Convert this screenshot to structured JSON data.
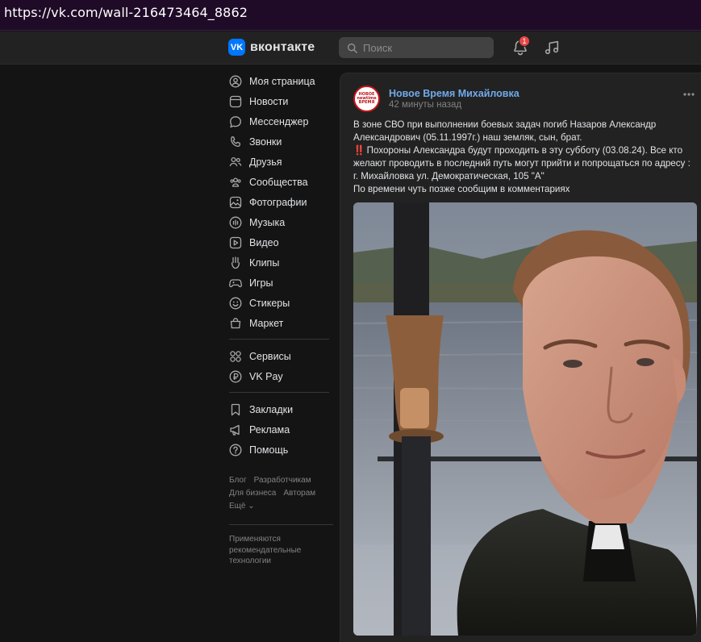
{
  "browser": {
    "url": "https://vk.com/wall-216473464_8862"
  },
  "header": {
    "logo_text": "вконтакте",
    "logo_mark": "VK",
    "search_placeholder": "Поиск",
    "notifications_count": "1",
    "icons": [
      "search-icon",
      "bell-icon",
      "music-icon"
    ],
    "accent": "#0077ff",
    "badge_color": "#e64646"
  },
  "sidebar": {
    "items": [
      {
        "label": "Моя страница",
        "icon": "profile-icon"
      },
      {
        "label": "Новости",
        "icon": "news-icon"
      },
      {
        "label": "Мессенджер",
        "icon": "messenger-icon"
      },
      {
        "label": "Звонки",
        "icon": "phone-icon"
      },
      {
        "label": "Друзья",
        "icon": "friends-icon"
      },
      {
        "label": "Сообщества",
        "icon": "communities-icon"
      },
      {
        "label": "Фотографии",
        "icon": "photos-icon"
      },
      {
        "label": "Музыка",
        "icon": "music-icon"
      },
      {
        "label": "Видео",
        "icon": "video-icon"
      },
      {
        "label": "Клипы",
        "icon": "clips-icon"
      },
      {
        "label": "Игры",
        "icon": "games-icon"
      },
      {
        "label": "Стикеры",
        "icon": "stickers-icon"
      },
      {
        "label": "Маркет",
        "icon": "market-icon"
      }
    ],
    "services": [
      {
        "label": "Сервисы",
        "icon": "services-icon"
      },
      {
        "label": "VK Pay",
        "icon": "vkpay-icon"
      }
    ],
    "extra": [
      {
        "label": "Закладки",
        "icon": "bookmark-icon"
      },
      {
        "label": "Реклама",
        "icon": "ads-icon"
      },
      {
        "label": "Помощь",
        "icon": "help-icon"
      }
    ],
    "footer_links": [
      "Блог",
      "Разработчикам",
      "Для бизнеса",
      "Авторам",
      "Ещё ⌄"
    ],
    "recommendation_note": "Применяются рекомендательные технологии"
  },
  "post": {
    "author": "Новое Время Михайловка",
    "time": "42 минуты назад",
    "avatar_text": "НОВОЕ newtime ВРЕМЯ",
    "text_line1": "В зоне СВО при выполнении боевых задач погиб Назаров Александр Александрович (05.11.1997г.) наш земляк, сын, брат.",
    "text_excl": "‼️",
    "text_line2": "Похороны Александра будут проходить в эту субботу (03.08.24). Все кто желают проводить в последний путь могут прийти и попрощаться по адресу : г. Михайловка ул. Демократическая, 105 \"А\"",
    "text_line3": "По времени чуть позже сообщим в комментариях",
    "link_color": "#71aaeb"
  }
}
